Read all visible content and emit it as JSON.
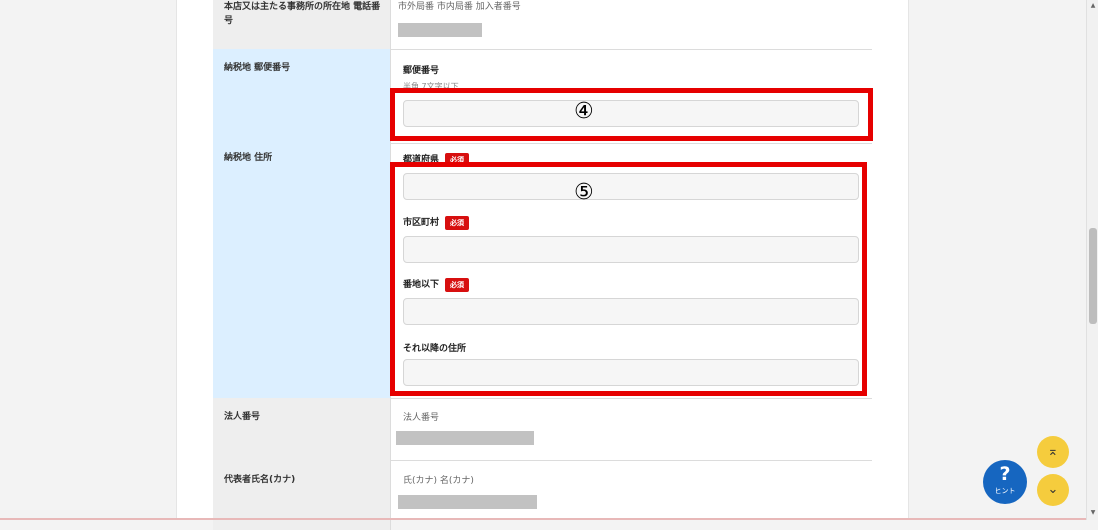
{
  "rows": {
    "head_office_phone": {
      "label": "本店又は主たる事務所の所在地 電話番号",
      "value_hint": "市外局番 市内局番 加入者番号"
    },
    "tax_postal": {
      "label": "納税地 郵便番号",
      "field_label": "郵便番号",
      "field_hint": "半角 7文字以下",
      "input_value": ""
    },
    "tax_address": {
      "label": "納税地 住所",
      "prefecture_label": "都道府県",
      "city_label": "市区町村",
      "street_label": "番地以下",
      "rest_label": "それ以降の住所",
      "required_badge": "必須"
    },
    "corporate_number": {
      "label": "法人番号",
      "value_hint": "法人番号"
    },
    "representative_kana": {
      "label": "代表者氏名(カナ)",
      "value_hint": "氏(カナ) 名(カナ)"
    }
  },
  "annotations": {
    "box4": "④",
    "box5": "⑤"
  },
  "floating": {
    "hint_icon": "question-icon",
    "hint_symbol": "?",
    "hint_label": "ヒント",
    "top_icon": "scroll-top-icon",
    "top_symbol": "⌅",
    "bottom_icon": "scroll-bottom-icon",
    "bottom_symbol": "⌄"
  },
  "scrollbar": {
    "up_symbol": "▲",
    "down_symbol": "▼"
  },
  "colors": {
    "required_badge": "#d70f0f",
    "highlight": "#e60000",
    "hint_button": "#1666c0",
    "nav_button": "#f5cc3d",
    "required_label_bg": "#dcefff"
  }
}
